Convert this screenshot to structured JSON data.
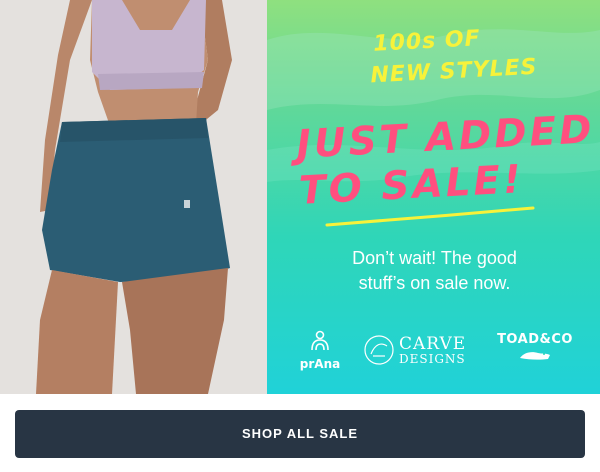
{
  "promo": {
    "kicker_line1": "100s OF",
    "kicker_line2": "NEW STYLES",
    "headline_line1": "JUST ADDED",
    "headline_line2": "TO SALE!",
    "subtext_line1": "Don’t wait! The good",
    "subtext_line2": "stuff’s on sale now.",
    "brands": [
      {
        "name": "prAna",
        "icon": "prana-logo"
      },
      {
        "name_line1": "CARVE",
        "name_line2": "DESIGNS",
        "icon": "carve-designs-logo"
      },
      {
        "name": "TOAD&CO",
        "icon": "toad-logo"
      }
    ]
  },
  "cta": {
    "label": "SHOP ALL SALE"
  },
  "colors": {
    "kicker": "#f7f23a",
    "headline": "#ff4f7f",
    "underline": "#f7f23a",
    "cta_background": "#283544",
    "photo_background": "#e4e1de"
  }
}
